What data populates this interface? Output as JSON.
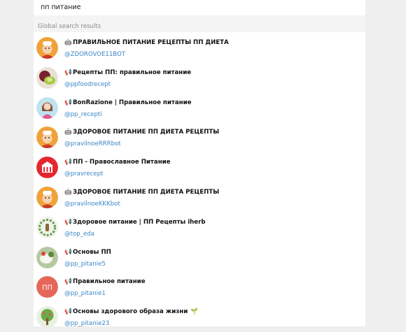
{
  "search": {
    "value": "пп питание"
  },
  "section": {
    "header": "Global search results"
  },
  "results": [
    {
      "kind": "bot-icon",
      "glyph": "🤖",
      "title": "ПРАВИЛЬНОЕ ПИТАНИЕ РЕЦЕПТЫ ПП ДИЕТА",
      "handle": "@ZDOROVOE11BOT",
      "avatar": "chef"
    },
    {
      "kind": "megaphone-icon",
      "glyph": "📢",
      "title": "Рецепты ПП: правильное питание",
      "handle": "@ppfoodrecept",
      "avatar": "food-photo-green"
    },
    {
      "kind": "megaphone-icon",
      "glyph": "📢",
      "title": "BonRazione | Правильное питание",
      "handle": "@pp_recepti",
      "avatar": "girl"
    },
    {
      "kind": "bot-icon",
      "glyph": "🤖",
      "title": "ЗДОРОВОЕ ПИТАНИЕ ПП ДИЕТА РЕЦЕПТЫ",
      "handle": "@pravilnoeRRRbot",
      "avatar": "chef"
    },
    {
      "kind": "megaphone-icon",
      "glyph": "📢",
      "title": "ПП - Православное Питание",
      "handle": "@pravrecept",
      "avatar": "church"
    },
    {
      "kind": "bot-icon",
      "glyph": "🤖",
      "title": "ЗДОРОВОЕ ПИТАНИЕ ПП ДИЕТА РЕЦЕПТЫ",
      "handle": "@pravilnoeKKKbot",
      "avatar": "chef"
    },
    {
      "kind": "megaphone-icon",
      "glyph": "📢",
      "title": "Здоровое питание | ПП Рецепты iherb",
      "handle": "@top_eda",
      "avatar": "wreath"
    },
    {
      "kind": "megaphone-icon",
      "glyph": "📢",
      "title": "Основы ПП",
      "handle": "@pp_pitanie5",
      "avatar": "food-photo-white"
    },
    {
      "kind": "megaphone-icon",
      "glyph": "📢",
      "title": "Правильное питание",
      "handle": "@pp_pitanie1",
      "avatar": "initials",
      "initials": "ПП"
    },
    {
      "kind": "megaphone-icon",
      "glyph": "📢",
      "title": "Основы здорового образа жизни",
      "title_suffix": "🌱",
      "handle": "@pp_pitanie23",
      "avatar": "tree"
    }
  ],
  "colors": {
    "link": "#3a86c6",
    "initials_bg": "#e5675a"
  }
}
